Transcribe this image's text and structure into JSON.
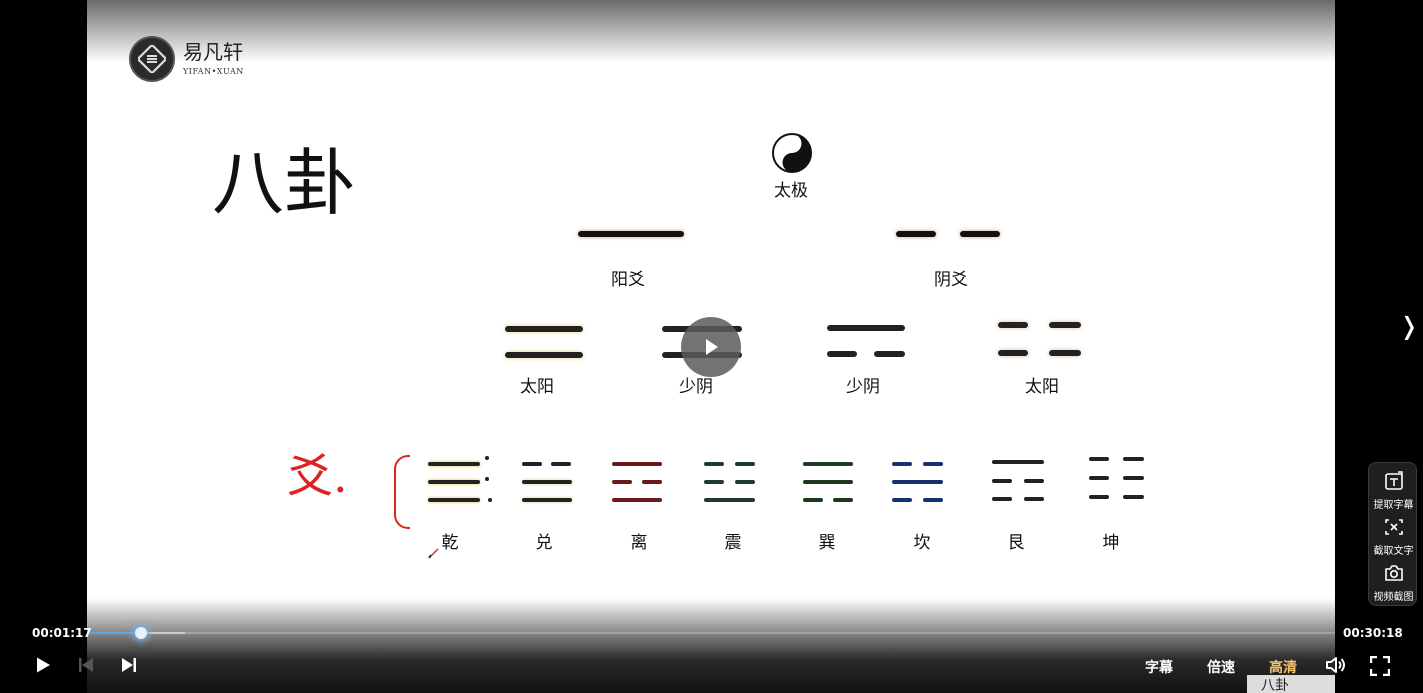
{
  "logo": {
    "cn": "易凡轩",
    "en": "YIFAN•XUAN"
  },
  "slide": {
    "title": "八卦",
    "taiji_label": "太极",
    "yao": [
      "阳爻",
      "阴爻"
    ],
    "four_images": [
      "太阳",
      "少阴",
      "少阴",
      "太阳"
    ],
    "annotation": "爻.",
    "trigrams": [
      "乾",
      "兑",
      "离",
      "震",
      "巽",
      "坎",
      "艮",
      "坤"
    ]
  },
  "player": {
    "current_time": "00:01:17",
    "total_time": "00:30:18",
    "progress_fraction": 0.042,
    "buttons": {
      "subtitle": "字幕",
      "speed": "倍速",
      "quality": "高清"
    },
    "quality_color": "#f5c36b",
    "accent_color": "#5aa9e6"
  },
  "tools": [
    {
      "label": "提取字幕",
      "icon": "extract-subtitle-icon"
    },
    {
      "label": "截取文字",
      "icon": "capture-text-icon"
    },
    {
      "label": "视频截图",
      "icon": "camera-icon"
    }
  ],
  "thumbnail": {
    "text": "八卦"
  }
}
